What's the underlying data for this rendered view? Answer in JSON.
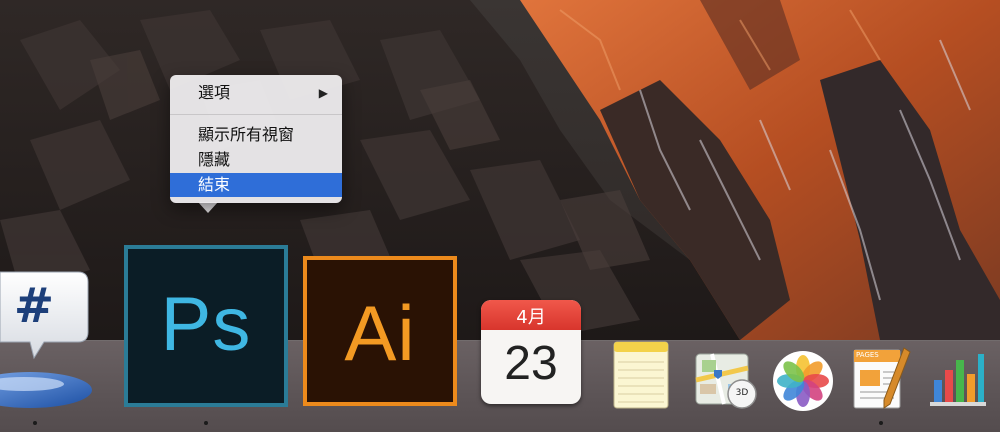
{
  "context_menu": {
    "items": [
      {
        "label": "選項",
        "has_submenu": true,
        "selected": false
      },
      {
        "label": "顯示所有視窗",
        "has_submenu": false,
        "selected": false
      },
      {
        "label": "隱藏",
        "has_submenu": false,
        "selected": false
      },
      {
        "label": "結束",
        "has_submenu": false,
        "selected": true
      }
    ],
    "submenu_glyph": "▶",
    "highlight_color": "#2f6ed8"
  },
  "dock": {
    "apps": [
      {
        "name": "hashtag-app",
        "running": true
      },
      {
        "name": "photoshop",
        "letters": "Ps",
        "running": true,
        "accent": "#3fb7e3"
      },
      {
        "name": "illustrator",
        "letters": "Ai",
        "running": false,
        "accent": "#f39a23"
      },
      {
        "name": "calendar",
        "running": false
      },
      {
        "name": "notes",
        "running": false
      },
      {
        "name": "maps",
        "running": false
      },
      {
        "name": "photos",
        "running": false
      },
      {
        "name": "pages",
        "running": true
      },
      {
        "name": "numbers",
        "running": false
      }
    ],
    "calendar": {
      "month": "4月",
      "day": "23"
    },
    "hashtag_symbol": "#",
    "maps_badge": "3D",
    "pages_label": "PAGES"
  }
}
